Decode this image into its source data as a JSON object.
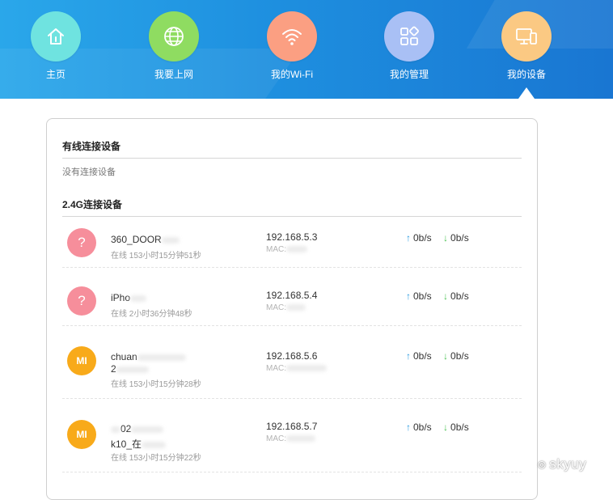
{
  "nav": {
    "items": [
      {
        "label": "主页",
        "icon": "home-icon",
        "color": "#6fe3e0"
      },
      {
        "label": "我要上网",
        "icon": "globe-icon",
        "color": "#8fdc61"
      },
      {
        "label": "我的Wi-Fi",
        "icon": "wifi-icon",
        "color": "#fb9f82"
      },
      {
        "label": "我的管理",
        "icon": "grid-icon",
        "color": "#a9c0f5"
      },
      {
        "label": "我的设备",
        "icon": "monitor-phone-icon",
        "color": "#fbc983"
      }
    ],
    "active_index": 4
  },
  "wired": {
    "title": "有线连接设备",
    "empty_text": "没有连接设备"
  },
  "wifi24": {
    "title": "2.4G连接设备",
    "devices": [
      {
        "icon": "?",
        "icon_type": "unknown",
        "name": "360_DOOR",
        "name2": "",
        "status": "在线 153小时15分钟51秒",
        "ip": "192.168.5.3",
        "mac": "MAC:",
        "up": "0b/s",
        "down": "0b/s"
      },
      {
        "icon": "?",
        "icon_type": "unknown",
        "name": "iPho",
        "name2": "",
        "status": "在线 2小时36分钟48秒",
        "ip": "192.168.5.4",
        "mac": "MAC:",
        "up": "0b/s",
        "down": "0b/s"
      },
      {
        "icon": "MI",
        "icon_type": "mi",
        "name": "chuan",
        "name2": "2",
        "status": "在线 153小时15分钟28秒",
        "ip": "192.168.5.6",
        "mac": "MAC:",
        "up": "0b/s",
        "down": "0b/s"
      },
      {
        "icon": "MI",
        "icon_type": "mi",
        "name": "02",
        "name2": "k10_在",
        "status": "在线 153小时15分钟22秒",
        "ip": "192.168.5.7",
        "mac": "MAC:",
        "up": "0b/s",
        "down": "0b/s"
      }
    ]
  },
  "speed_arrows": {
    "up": "↑",
    "down": "↓"
  },
  "watermark": {
    "logo": "⊚",
    "text": "skyuy"
  }
}
